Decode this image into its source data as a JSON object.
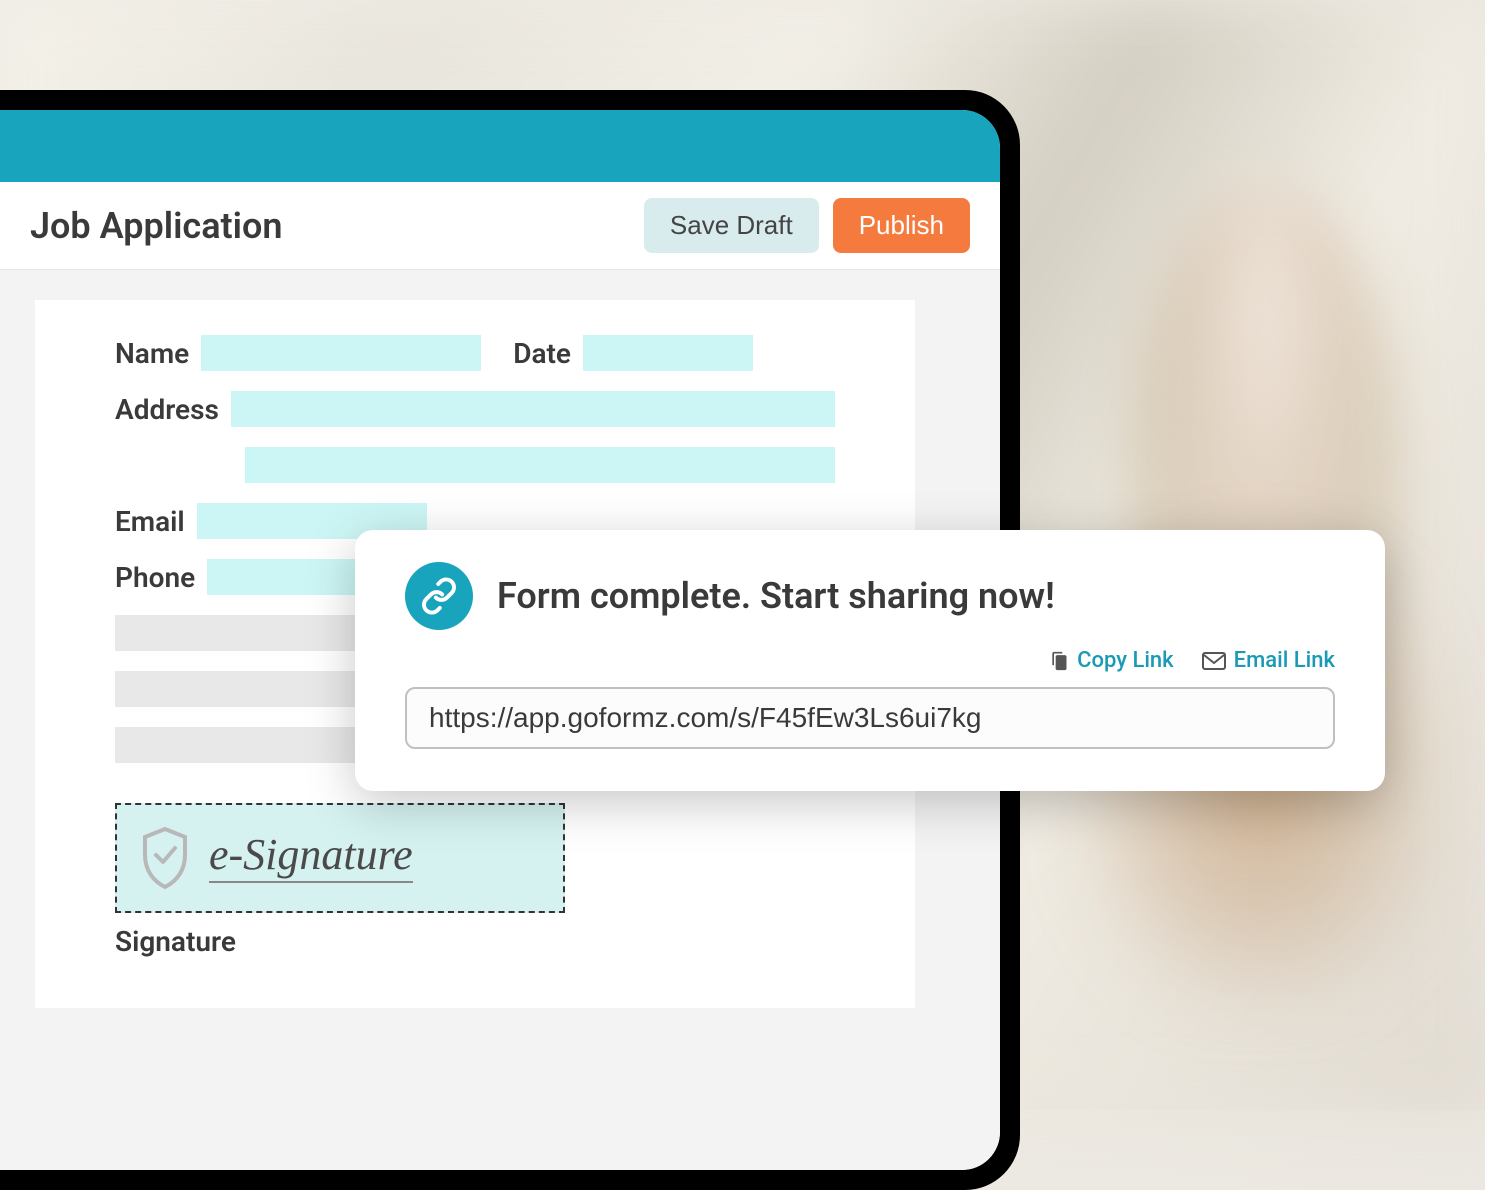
{
  "header": {
    "title": "Job Application",
    "save_draft_label": "Save Draft",
    "publish_label": "Publish"
  },
  "form": {
    "name_label": "Name",
    "date_label": "Date",
    "address_label": "Address",
    "email_label": "Email",
    "phone_label": "Phone",
    "signature_placeholder": "e-Signature",
    "signature_label": "Signature"
  },
  "share_popup": {
    "title": "Form complete. Start sharing now!",
    "copy_link_label": "Copy Link",
    "email_link_label": "Email Link",
    "url": "https://app.goformz.com/s/F45fEw3Ls6ui7kg"
  },
  "colors": {
    "accent_teal": "#18a4bc",
    "accent_orange": "#f47a3e",
    "input_bg": "#ccf6f5"
  }
}
